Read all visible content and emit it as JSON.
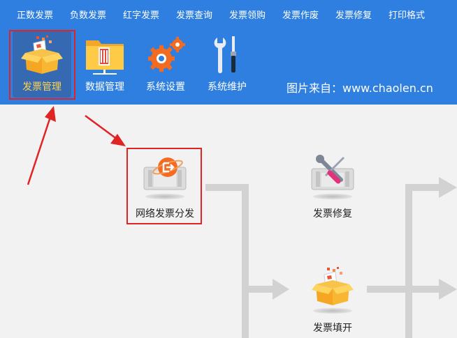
{
  "menu": {
    "items": [
      "正数发票",
      "负数发票",
      "红字发票",
      "发票查询",
      "发票领购",
      "发票作废",
      "发票修复",
      "打印格式"
    ]
  },
  "toolbar": {
    "tools": [
      {
        "label": "发票管理",
        "icon": "invoice-box-icon",
        "selected": true
      },
      {
        "label": "数据管理",
        "icon": "folder-data-icon",
        "selected": false
      },
      {
        "label": "系统设置",
        "icon": "gears-icon",
        "selected": false
      },
      {
        "label": "系统维护",
        "icon": "wrench-screwdriver-icon",
        "selected": false
      }
    ]
  },
  "watermark": "图片来自：www.chaolen.cn",
  "flow": {
    "nodes": [
      {
        "label": "网络发票分发",
        "icon": "network-dispatch-icon"
      },
      {
        "label": "发票修复",
        "icon": "repair-tools-icon"
      },
      {
        "label": "发票填开",
        "icon": "invoice-box-icon"
      }
    ]
  },
  "colors": {
    "header": "#2e7fe0",
    "highlight": "#e02424",
    "arrow": "#e02424",
    "connector": "#d0d0d0",
    "selected_label": "#ffd24a"
  }
}
